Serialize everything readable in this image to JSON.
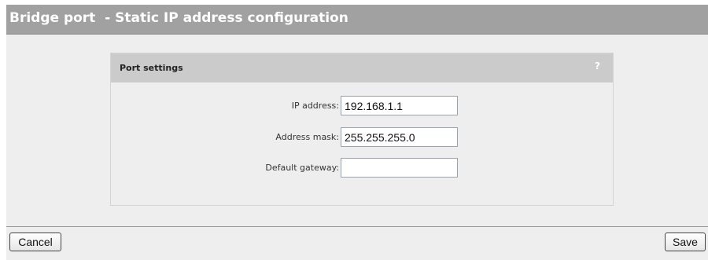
{
  "header": {
    "title": "Bridge port  - Static IP address configuration"
  },
  "panel": {
    "title": "Port settings",
    "help_label": "?"
  },
  "form": {
    "fields": [
      {
        "label": "IP address:",
        "value": "192.168.1.1",
        "placeholder": ""
      },
      {
        "label": "Address mask:",
        "value": "255.255.255.0",
        "placeholder": ""
      },
      {
        "label": "Default gateway:",
        "value": "",
        "placeholder": ""
      }
    ]
  },
  "footer": {
    "cancel_label": "Cancel",
    "save_label": "Save"
  },
  "colors": {
    "header_background": "#a1a1a1",
    "panel_header_background": "#cbcbcb",
    "page_background": "#eeeeee"
  }
}
